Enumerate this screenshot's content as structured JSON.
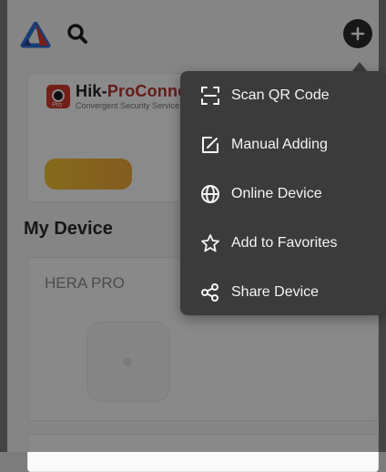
{
  "header": {
    "logo_icon": "hik-connect-logo-icon",
    "search_icon": "search-icon",
    "add_icon": "plus-icon"
  },
  "banner": {
    "title_part1": "Hik-",
    "title_part2": "ProConnect",
    "subtitle": "Convergent Security Service S",
    "badge_text": "Pro",
    "accent_color": "#b4342c",
    "cta_color": "#f1c232"
  },
  "section": {
    "title": "My Device"
  },
  "devices": [
    {
      "name": "HERA PRO",
      "share_icon": "share-icon",
      "settings_icon": "settings-icon"
    }
  ],
  "menu": {
    "items": [
      {
        "label": "Scan QR Code",
        "icon": "scan-qr-icon"
      },
      {
        "label": "Manual Adding",
        "icon": "edit-icon"
      },
      {
        "label": "Online Device",
        "icon": "globe-icon"
      },
      {
        "label": "Add to Favorites",
        "icon": "star-icon"
      },
      {
        "label": "Share Device",
        "icon": "share-icon"
      }
    ],
    "background": "#3b3b3b",
    "text_color": "#f4f4f4"
  }
}
